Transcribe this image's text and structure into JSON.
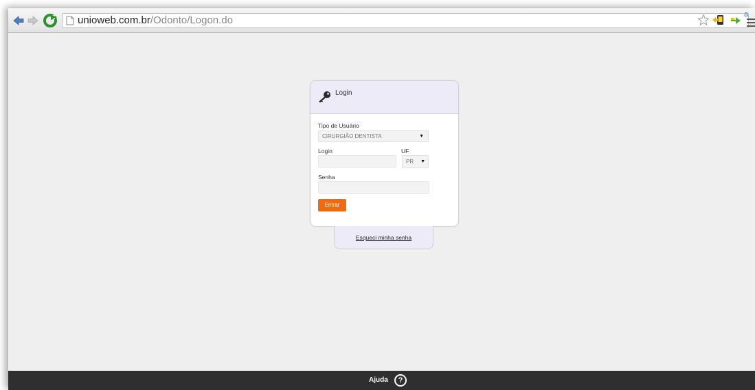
{
  "browser": {
    "url_host": "unioweb.com.br",
    "url_path": "/Odonto/Logon.do",
    "icons": [
      "back-arrow-icon",
      "forward-arrow-icon",
      "reload-icon",
      "page-icon",
      "bookmark-star-icon",
      "extension-icon",
      "extension-arrow-icon",
      "chrome-menu-icon"
    ],
    "menu_superscript": "a"
  },
  "login": {
    "title": "Login",
    "icon": "key-icon",
    "user_type_label": "Tipo de Usuário",
    "user_type_value": "CIRURGIÃO DENTISTA",
    "login_label": "Login",
    "login_value": "",
    "uf_label": "UF",
    "uf_value": "PR",
    "password_label": "Senha",
    "password_value": "",
    "submit_label": "Entrar",
    "forgot_label": "Esqueci minha senha",
    "accent_color": "#f06a12"
  },
  "footer": {
    "help_label": "Ajuda",
    "help_icon": "question-circle-icon",
    "help_glyph": "?"
  }
}
